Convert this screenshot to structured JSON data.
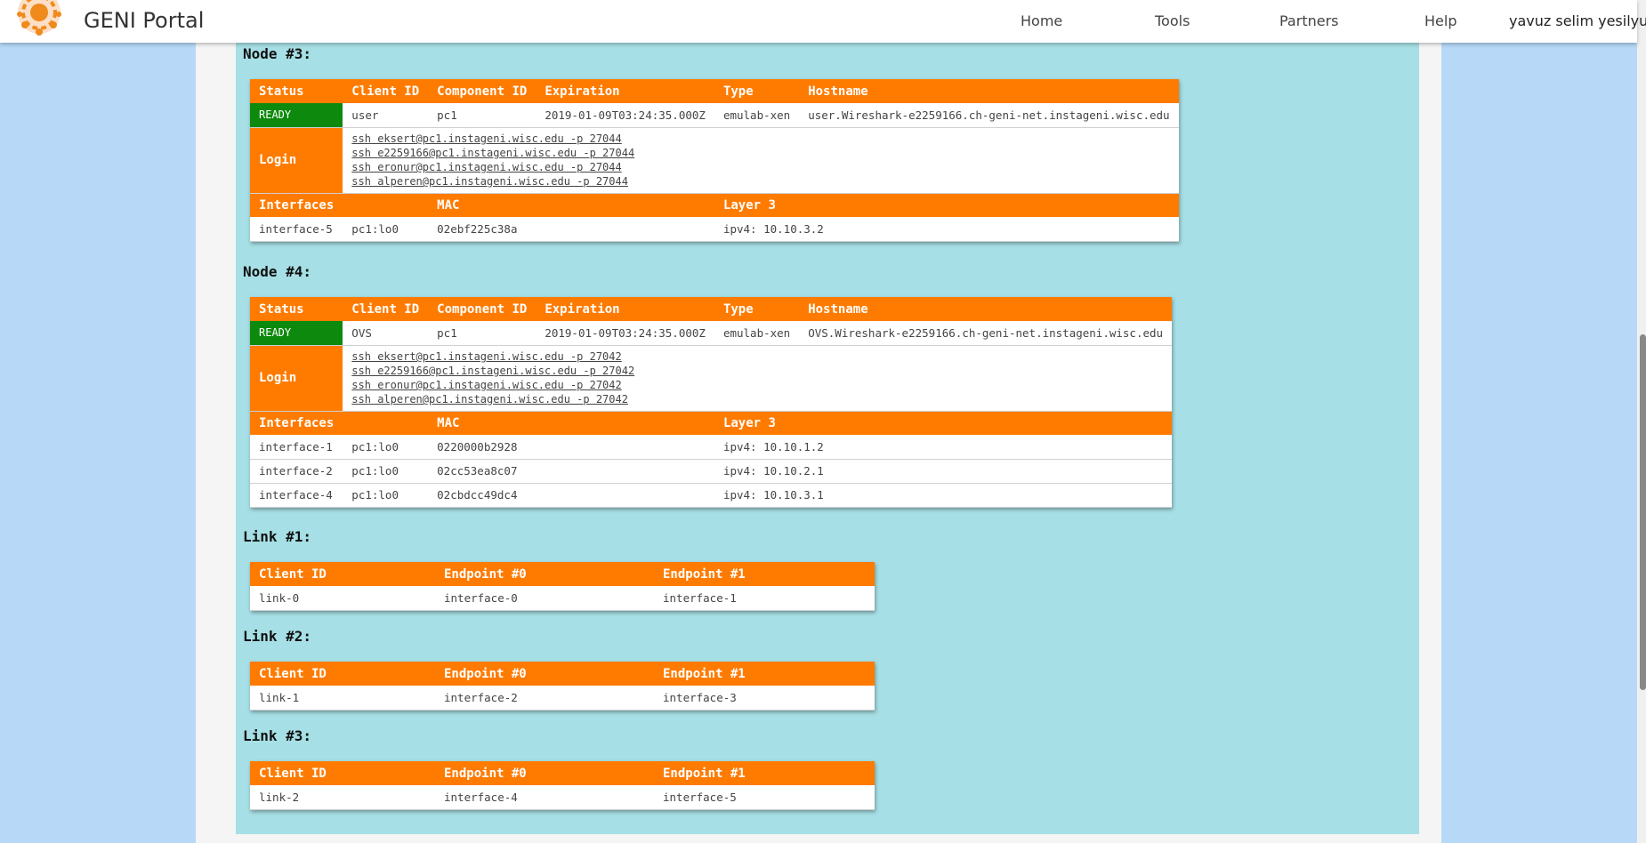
{
  "nav": {
    "brand": "GENI Portal",
    "items": [
      "Home",
      "Tools",
      "Partners",
      "Help"
    ],
    "user": "yavuz selim yesilyurt"
  },
  "node3": {
    "title": "Node #3:",
    "headers": [
      "Status",
      "Client ID",
      "Component ID",
      "Expiration",
      "Type",
      "Hostname"
    ],
    "row": [
      "READY",
      "user",
      "pc1",
      "2019-01-09T03:24:35.000Z",
      "emulab-xen",
      "user.Wireshark-e2259166.ch-geni-net.instageni.wisc.edu"
    ],
    "login_label": "Login",
    "logins": [
      "ssh eksert@pc1.instageni.wisc.edu -p 27044",
      "ssh e2259166@pc1.instageni.wisc.edu -p 27044",
      "ssh eronur@pc1.instageni.wisc.edu -p 27044",
      "ssh alperen@pc1.instageni.wisc.edu -p 27044"
    ],
    "iface_headers": [
      "Interfaces",
      "MAC",
      "Layer 3"
    ],
    "interfaces": [
      [
        "interface-5",
        "pc1:lo0",
        "02ebf225c38a",
        "ipv4: 10.10.3.2"
      ]
    ]
  },
  "node4": {
    "title": "Node #4:",
    "headers": [
      "Status",
      "Client ID",
      "Component ID",
      "Expiration",
      "Type",
      "Hostname"
    ],
    "row": [
      "READY",
      "OVS",
      "pc1",
      "2019-01-09T03:24:35.000Z",
      "emulab-xen",
      "OVS.Wireshark-e2259166.ch-geni-net.instageni.wisc.edu"
    ],
    "login_label": "Login",
    "logins": [
      "ssh eksert@pc1.instageni.wisc.edu -p 27042",
      "ssh e2259166@pc1.instageni.wisc.edu -p 27042",
      "ssh eronur@pc1.instageni.wisc.edu -p 27042",
      "ssh alperen@pc1.instageni.wisc.edu -p 27042"
    ],
    "iface_headers": [
      "Interfaces",
      "MAC",
      "Layer 3"
    ],
    "interfaces": [
      [
        "interface-1",
        "pc1:lo0",
        "0220000b2928",
        "ipv4: 10.10.1.2"
      ],
      [
        "interface-2",
        "pc1:lo0",
        "02cc53ea8c07",
        "ipv4: 10.10.2.1"
      ],
      [
        "interface-4",
        "pc1:lo0",
        "02cbdcc49dc4",
        "ipv4: 10.10.3.1"
      ]
    ]
  },
  "links": [
    {
      "title": "Link #1:",
      "headers": [
        "Client ID",
        "Endpoint #0",
        "Endpoint #1"
      ],
      "row": [
        "link-0",
        "interface-0",
        "interface-1"
      ]
    },
    {
      "title": "Link #2:",
      "headers": [
        "Client ID",
        "Endpoint #0",
        "Endpoint #1"
      ],
      "row": [
        "link-1",
        "interface-2",
        "interface-3"
      ]
    },
    {
      "title": "Link #3:",
      "headers": [
        "Client ID",
        "Endpoint #0",
        "Endpoint #1"
      ],
      "row": [
        "link-2",
        "interface-4",
        "interface-5"
      ]
    }
  ],
  "colors": {
    "header": "#ff7b00",
    "ready": "#0d8a0d",
    "content_bg": "#a6dfe5",
    "page_bg": "#b7d9f7"
  }
}
